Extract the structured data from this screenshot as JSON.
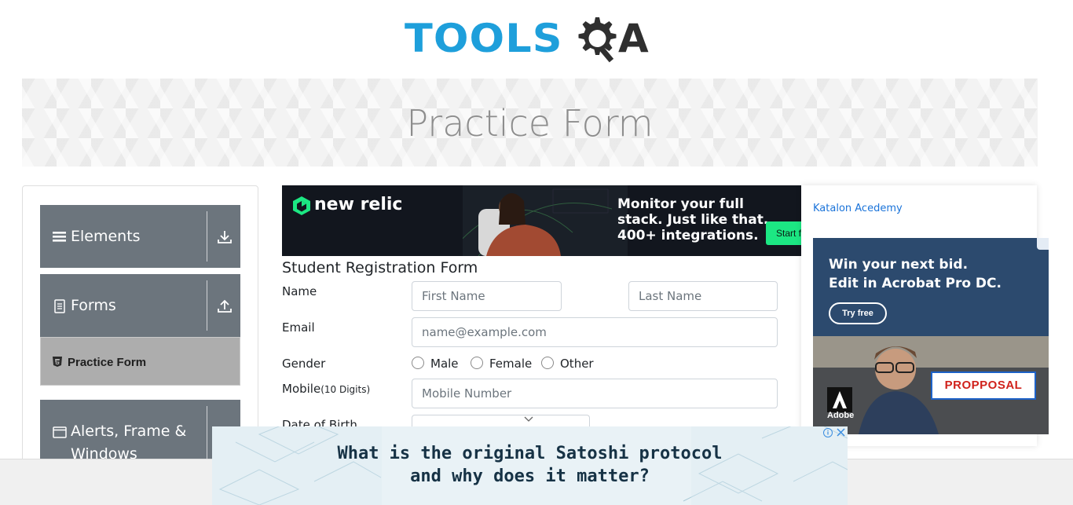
{
  "header": {
    "logo_text_left": "TOOLS",
    "logo_text_right": "A"
  },
  "banner": {
    "title": "Practice Form"
  },
  "sidebar": {
    "groups": [
      {
        "label": "Elements",
        "icon": "list-icon",
        "arrow": "download-icon"
      },
      {
        "label": "Forms",
        "icon": "document-icon",
        "arrow": "upload-icon"
      },
      {
        "label": "Alerts, Frame &",
        "label2": "Windows",
        "icon": "window-icon",
        "arrow": "download-icon"
      }
    ],
    "active_item": {
      "label": "Practice Form",
      "icon": "html5-icon"
    }
  },
  "top_ad": {
    "brand": "new relic",
    "headline_1": "Monitor your full",
    "headline_2": "stack. Just like that.",
    "headline_3": "400+ integrations.",
    "cta": "Start f"
  },
  "form": {
    "title": "Student Registration Form",
    "name_label": "Name",
    "first_name_placeholder": "First Name",
    "last_name_placeholder": "Last Name",
    "email_label": "Email",
    "email_placeholder": "name@example.com",
    "gender_label": "Gender",
    "gender_options": [
      "Male",
      "Female",
      "Other"
    ],
    "mobile_label": "Mobile",
    "mobile_hint": "(10 Digits)",
    "mobile_placeholder": "Mobile Number",
    "dob_label": "Date of Birth"
  },
  "right_ad": {
    "link": "Katalon Acedemy",
    "headline_1": "Win your next bid.",
    "headline_2": "Edit in Acrobat Pro DC.",
    "cta": "Try free",
    "brand": "Adobe",
    "proposal_text": "PROPPOSAL"
  },
  "bottom_ad": {
    "line_1": "What is the original Satoshi protocol",
    "line_2": "and why does it matter?"
  },
  "colors": {
    "logo_blue": "#1e9fdb",
    "sidebar_group": "#6c757d",
    "sidebar_active": "#adadad",
    "link_blue": "#1a73d9"
  }
}
